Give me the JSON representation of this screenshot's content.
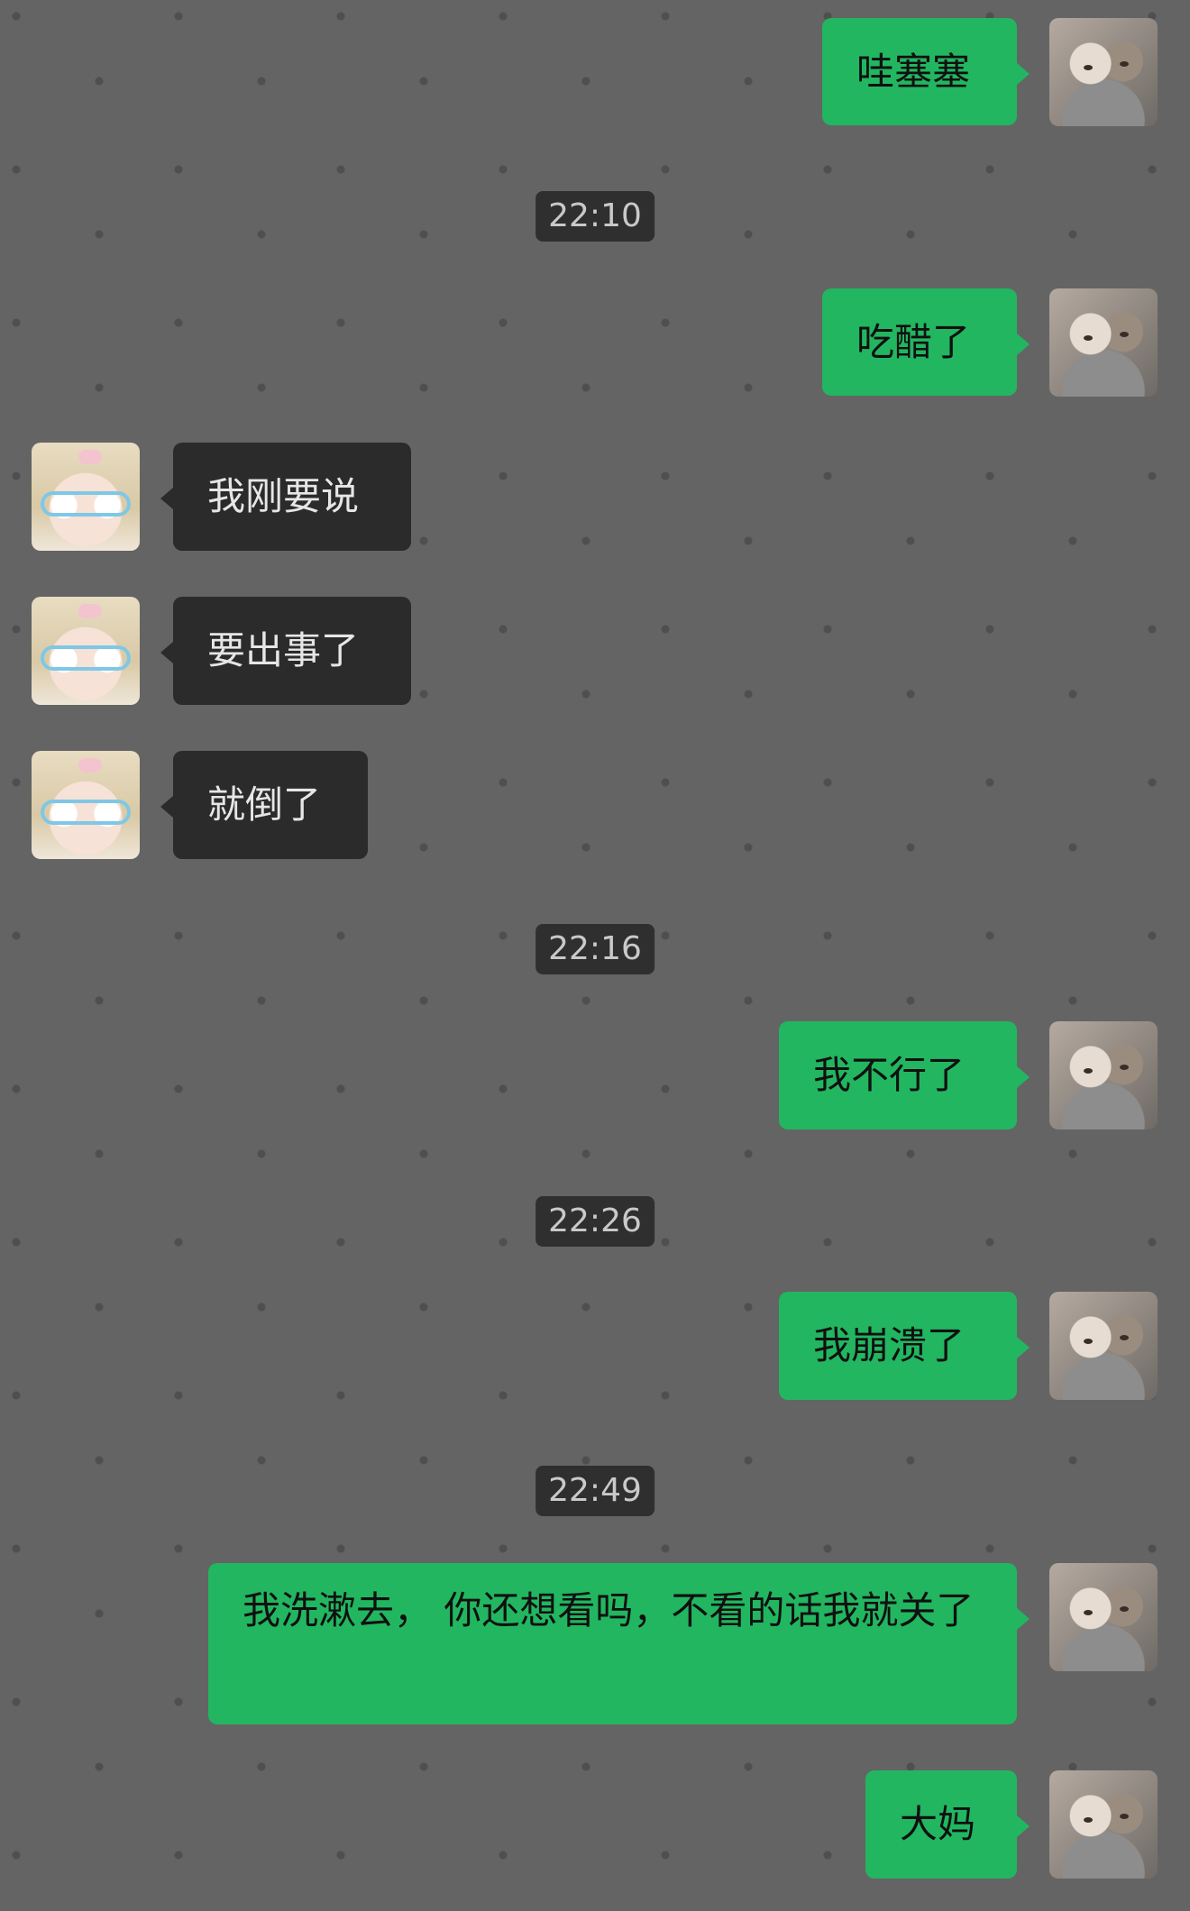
{
  "messages": [
    {
      "side": "sent",
      "text": "哇塞塞"
    },
    {
      "type": "time",
      "text": "22:10"
    },
    {
      "side": "sent",
      "text": "吃醋了"
    },
    {
      "side": "recv",
      "text": "我刚要说"
    },
    {
      "side": "recv",
      "text": "要出事了"
    },
    {
      "side": "recv",
      "text": "就倒了"
    },
    {
      "type": "time",
      "text": "22:16"
    },
    {
      "side": "sent",
      "text": "我不行了"
    },
    {
      "type": "time",
      "text": "22:26"
    },
    {
      "side": "sent",
      "text": "我崩溃了"
    },
    {
      "type": "time",
      "text": "22:49"
    },
    {
      "side": "sent",
      "text": "我洗漱去， 你还想看吗，不看的话我就关了"
    },
    {
      "side": "sent",
      "text": "大妈"
    }
  ],
  "colors": {
    "background": "#646464",
    "sent_bubble": "#22b660",
    "received_bubble": "#2b2b2b",
    "time_badge": "#2f2f2f"
  },
  "icons": {
    "self_avatar": "kitten-photo-avatar-icon",
    "contact_avatar": "anime-girl-avatar-icon"
  }
}
